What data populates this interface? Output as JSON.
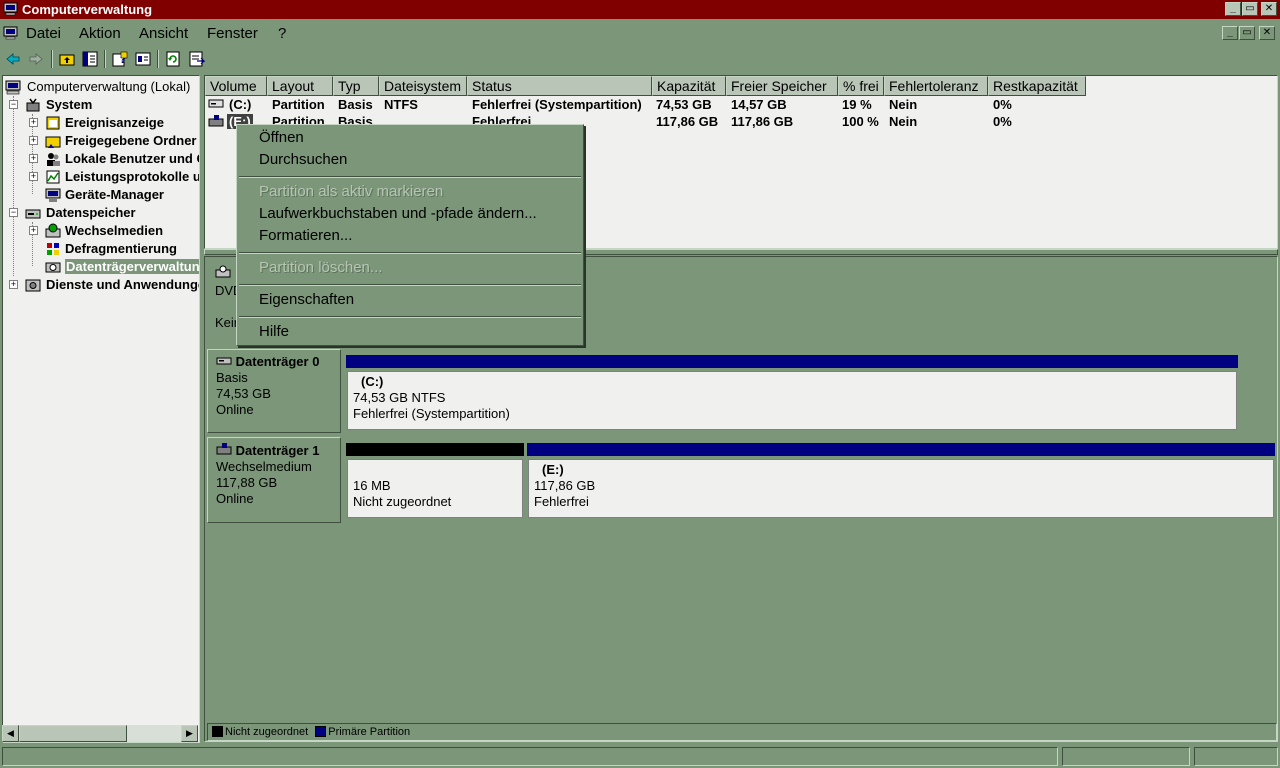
{
  "window": {
    "title": "Computerverwaltung"
  },
  "menubar": {
    "items": [
      "Datei",
      "Aktion",
      "Ansicht",
      "Fenster",
      "?"
    ]
  },
  "tree": {
    "root": "Computerverwaltung (Lokal)",
    "system": "System",
    "ereignis": "Ereignisanzeige",
    "freigaben": "Freigegebene Ordner",
    "benutzer": "Lokale Benutzer und Gruppen",
    "leistung": "Leistungsprotokolle und Warnungen",
    "geraete": "Geräte-Manager",
    "datenspeicher": "Datenspeicher",
    "wechsel": "Wechselmedien",
    "defrag": "Defragmentierung",
    "datentraeger": "Datenträgerverwaltung",
    "dienste": "Dienste und Anwendungen"
  },
  "volume_list": {
    "columns": [
      "Volume",
      "Layout",
      "Typ",
      "Dateisystem",
      "Status",
      "Kapazität",
      "Freier Speicher",
      "% frei",
      "Fehlertoleranz",
      "Restkapazität"
    ],
    "rows": [
      [
        "(C:)",
        "Partition",
        "Basis",
        "NTFS",
        "Fehlerfrei (Systempartition)",
        "74,53 GB",
        "14,57 GB",
        "19 %",
        "Nein",
        "0%"
      ],
      [
        "(E:)",
        "Partition",
        "Basis",
        "",
        "Fehlerfrei",
        "117,86 GB",
        "117,86 GB",
        "100 %",
        "Nein",
        "0%"
      ]
    ]
  },
  "disks": {
    "cdrom": {
      "type_partial": "DVD",
      "media_partial": "Kein"
    },
    "disk0": {
      "name": "Datenträger 0",
      "type": "Basis",
      "size": "74,53 GB",
      "status": "Online",
      "vol_c": {
        "letter": "(C:)",
        "size": "74,53 GB NTFS",
        "status": "Fehlerfrei (Systempartition)"
      }
    },
    "disk1": {
      "name": "Datenträger 1",
      "type": "Wechselmedium",
      "size": "117,88 GB",
      "status": "Online",
      "unalloc": {
        "size": "16 MB",
        "status": "Nicht zugeordnet"
      },
      "vol_e": {
        "letter": "(E:)",
        "size": "117,86 GB",
        "status": "Fehlerfrei"
      }
    }
  },
  "legend": {
    "unallocated": "Nicht zugeordnet",
    "primary": "Primäre Partition"
  },
  "context_menu": {
    "open": "Öffnen",
    "explore": "Durchsuchen",
    "mark_active": "Partition als aktiv markieren",
    "change_letter": "Laufwerkbuchstaben und -pfade ändern...",
    "format": "Formatieren...",
    "delete": "Partition löschen...",
    "properties": "Eigenschaften",
    "help": "Hilfe"
  },
  "colors": {
    "face": "#7b9679",
    "title": "#800000",
    "primary": "#000080",
    "unallocated": "#000000"
  },
  "icons": [
    "computer-icon",
    "back-icon",
    "forward-icon",
    "up-folder-icon",
    "show-tree-icon",
    "help-icon",
    "properties-icon",
    "refresh-icon",
    "export-icon"
  ]
}
